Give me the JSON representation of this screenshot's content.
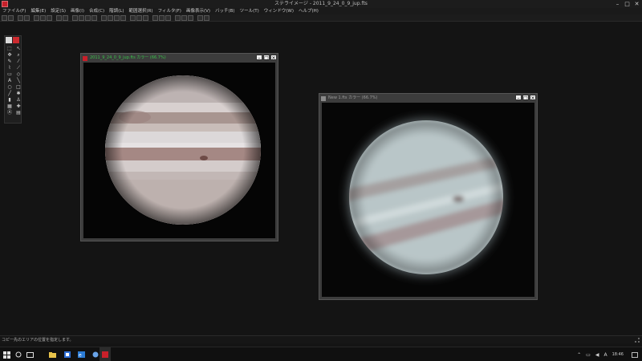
{
  "app": {
    "title": "ステライメージ - 2011_9_24_0_9_jup.fts"
  },
  "window_controls": {
    "minimize": "–",
    "maximize": "□",
    "close": "✕"
  },
  "menu": [
    "ファイル(F)",
    "編集(E)",
    "設定(S)",
    "画像(I)",
    "合成(C)",
    "階調(L)",
    "範囲選択(R)",
    "フィルタ(F)",
    "画像表示(V)",
    "バッチ(B)",
    "ツール(T)",
    "ウィンドウ(W)",
    "ヘルプ(H)"
  ],
  "image_windows": [
    {
      "title": "2011_9_24_0_9_jup.fts カラー (66.7%)",
      "color_accent": "#39c04a"
    },
    {
      "title": "New 1.fts カラー (66.7%)",
      "color_accent": "#9a9a9a"
    }
  ],
  "status": {
    "text": "コピー先のエリアの位置を指定します。"
  },
  "taskbar": {
    "clock": "18:46",
    "tray_icons": [
      "chevron-up-icon",
      "network-icon",
      "volume-icon",
      "ime-icon"
    ],
    "ime_label": "A"
  }
}
